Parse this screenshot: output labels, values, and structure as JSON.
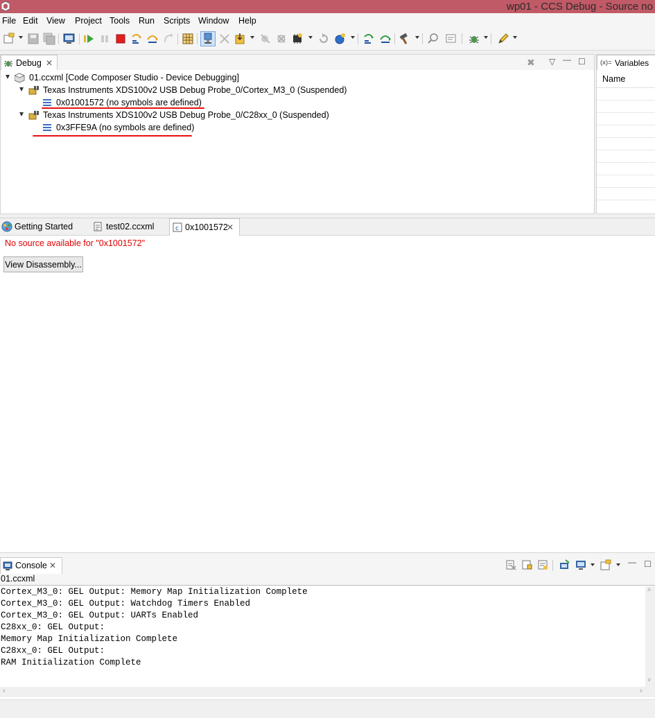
{
  "window": {
    "title": "wp01 - CCS Debug - Source no"
  },
  "menu": [
    "File",
    "Edit",
    "View",
    "Project",
    "Tools",
    "Run",
    "Scripts",
    "Window",
    "Help"
  ],
  "toolbar_icons": [
    "new-icon",
    "save-icon",
    "save-all-icon",
    "terminal-icon",
    "resume-icon",
    "suspend-icon",
    "terminate-icon",
    "step-into-icon",
    "step-over-icon",
    "step-return-icon",
    "memory-grid-icon",
    "connect-target-icon",
    "disconnect-icon",
    "load-program-icon",
    "breakpoint-icon",
    "remove-breakpoints-icon",
    "chip-icon",
    "restart-icon",
    "reset-icon",
    "assembly-step-into-icon",
    "assembly-step-over-icon",
    "build-hammer-icon",
    "search-icon",
    "comment-icon",
    "debug-bug-icon",
    "edit-pencil-icon"
  ],
  "debug": {
    "tab_label": "Debug",
    "tree": [
      {
        "label": "01.ccxml [Code Composer Studio - Device Debugging]"
      },
      {
        "label": "Texas Instruments XDS100v2 USB Debug Probe_0/Cortex_M3_0 (Suspended)"
      },
      {
        "label": "0x01001572  (no symbols are defined)"
      },
      {
        "label": "Texas Instruments XDS100v2 USB Debug Probe_0/C28xx_0 (Suspended)"
      },
      {
        "label": "0x3FFE9A  (no symbols are defined)"
      }
    ]
  },
  "variables": {
    "tab_label": "Variables",
    "tab_prefix": "(x)=",
    "column": "Name"
  },
  "editor": {
    "tabs": [
      {
        "label": "Getting Started"
      },
      {
        "label": "test02.ccxml"
      },
      {
        "label": "0x1001572"
      }
    ],
    "message": "No source available for \"0x1001572\"",
    "button": "View Disassembly..."
  },
  "console": {
    "tab_label": "Console",
    "subtitle": "01.ccxml",
    "lines": [
      "Cortex_M3_0: GEL Output: Memory Map Initialization Complete",
      "Cortex_M3_0: GEL Output: Watchdog Timers Enabled",
      "Cortex_M3_0: GEL Output: UARTs Enabled",
      "C28xx_0: GEL Output:",
      "Memory Map Initialization Complete",
      "C28xx_0: GEL Output:",
      "RAM Initialization Complete"
    ]
  },
  "colors": {
    "titlebar": "#c05a66",
    "error_text": "#e00000",
    "annotation_red": "#e81010",
    "thread_icon": "#3a6fc4"
  }
}
